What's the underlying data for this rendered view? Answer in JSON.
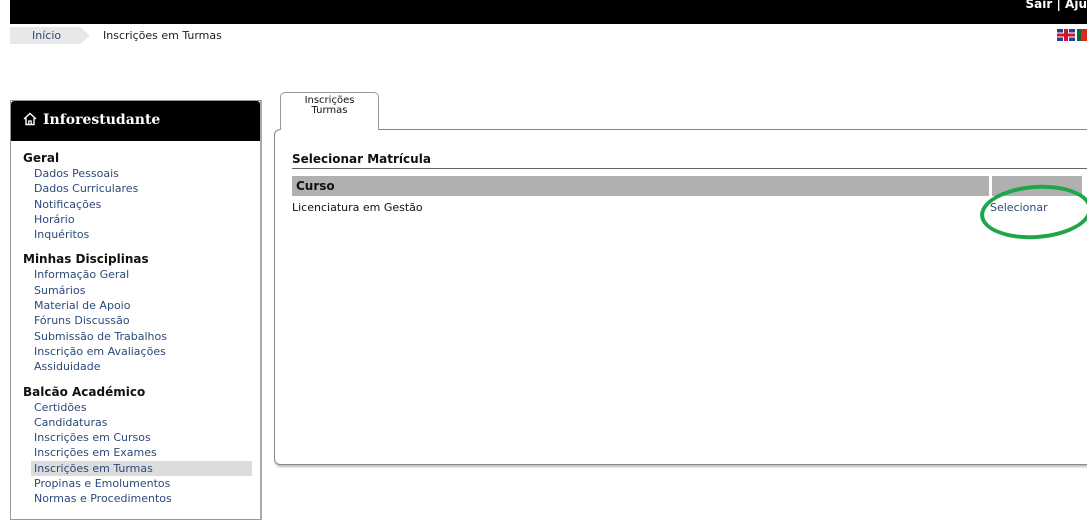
{
  "topbar": {
    "logout": "Sair",
    "separator": "|",
    "help": "Aju"
  },
  "breadcrumb": {
    "home": "Início",
    "current": "Inscrições em Turmas"
  },
  "flags": {
    "english": "uk-flag-icon",
    "portuguese": "pt-flag-icon"
  },
  "sidebar": {
    "title": "Inforestudante",
    "title_icon": "home-icon",
    "sections": [
      {
        "title": "Geral",
        "items": [
          "Dados Pessoais",
          "Dados Curriculares",
          "Notificações",
          "Horário",
          "Inquéritos"
        ]
      },
      {
        "title": "Minhas Disciplinas",
        "items": [
          "Informação Geral",
          "Sumários",
          "Material de Apoio",
          "Fóruns Discussão",
          "Submissão de Trabalhos",
          "Inscrição em Avaliações",
          "Assiduidade"
        ]
      },
      {
        "title": "Balcão Académico",
        "items": [
          "Certidões",
          "Candidaturas",
          "Inscrições em Cursos",
          "Inscrições em Exames",
          "Inscrições em Turmas",
          "Propinas e Emolumentos",
          "Normas e Procedimentos"
        ]
      }
    ],
    "active_item": "Inscrições em Turmas"
  },
  "tab": {
    "line1": "Inscrições",
    "line2": "Turmas"
  },
  "panel": {
    "title": "Selecionar Matrícula",
    "column_header": "Curso",
    "rows": [
      {
        "course": "Licenciatura em Gestão",
        "action": "Selecionar"
      }
    ]
  },
  "colors": {
    "link": "#2b4a7a",
    "highlight_ring": "#1fa64a",
    "header_bg": "#000000",
    "table_header": "#b0b0b0"
  }
}
